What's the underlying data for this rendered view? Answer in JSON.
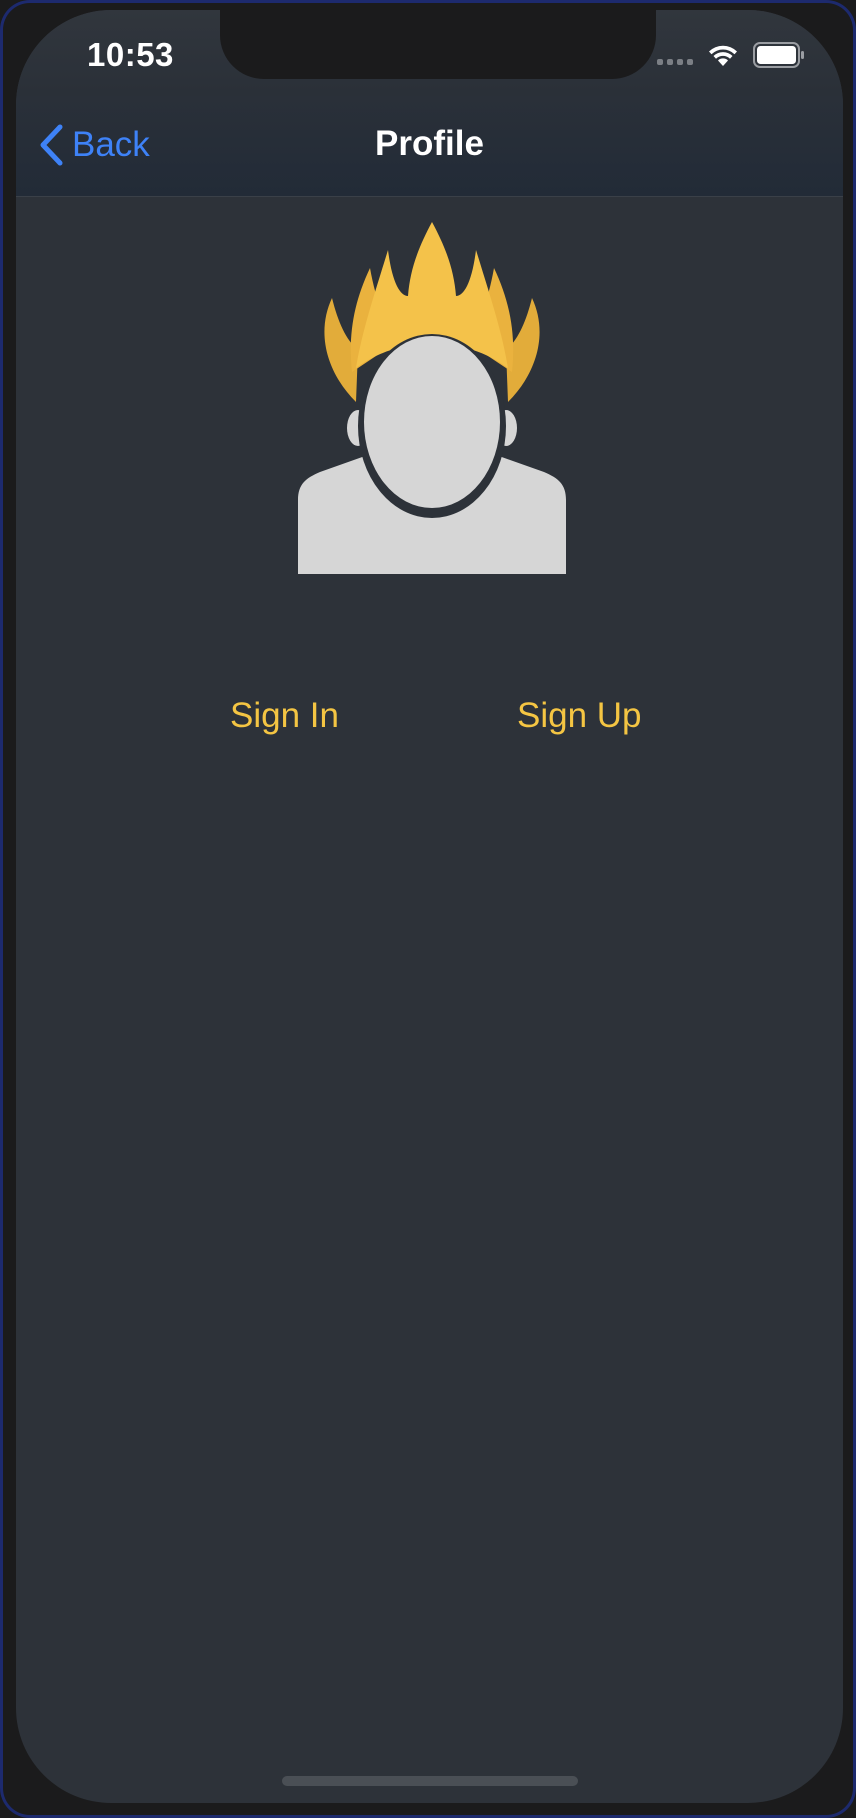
{
  "status_bar": {
    "time": "10:53",
    "icons": [
      "cellular-signal-icon",
      "wifi-icon",
      "battery-icon"
    ]
  },
  "nav": {
    "back_label": "Back",
    "title": "Profile"
  },
  "avatar": {
    "icon": "user-avatar-flame-hair-icon"
  },
  "auth": {
    "sign_in_label": "Sign In",
    "sign_up_label": "Sign Up"
  },
  "colors": {
    "background": "#2d3239",
    "nav_background": "#222b37",
    "link_blue": "#3e82f7",
    "accent_yellow": "#f4c543",
    "avatar_gray": "#d6d6d6"
  }
}
